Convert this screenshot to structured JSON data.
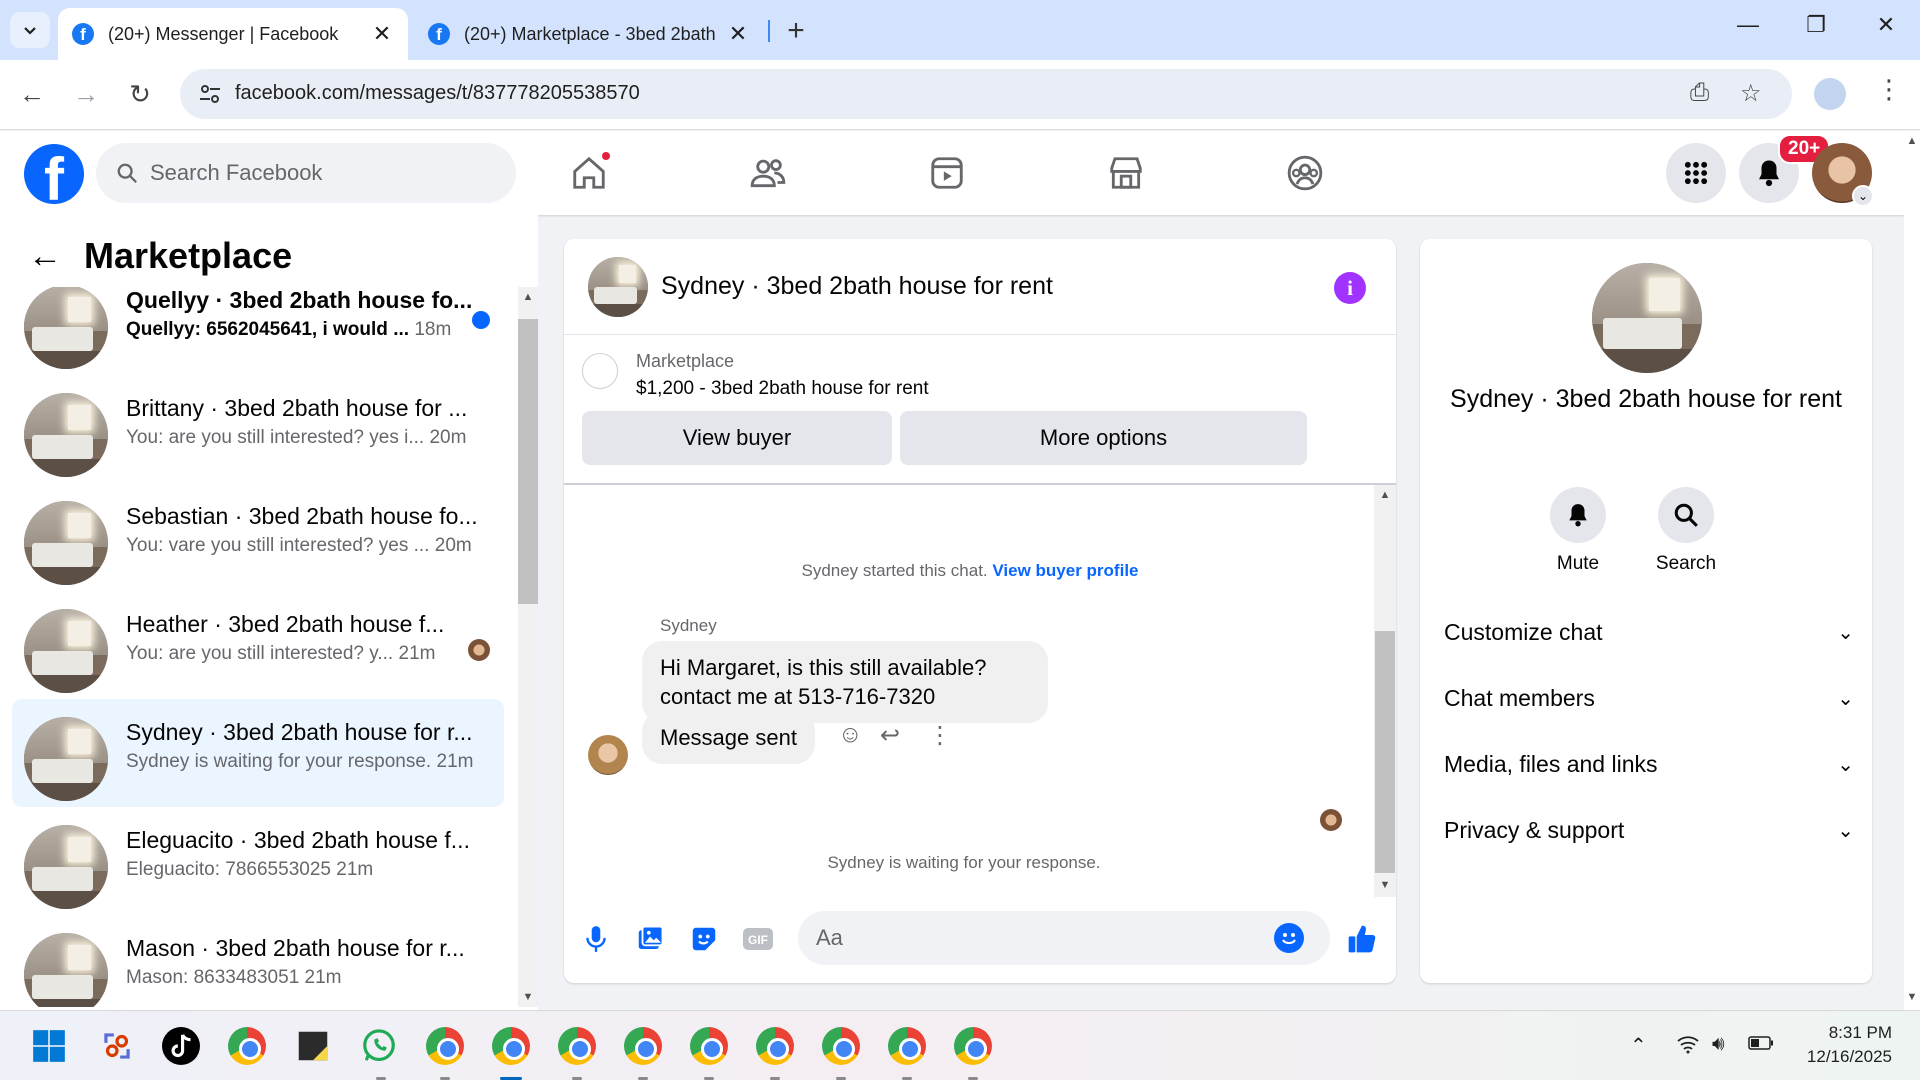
{
  "browser": {
    "tabs": [
      {
        "title": "(20+) Messenger | Facebook",
        "active": true
      },
      {
        "title": "(20+) Marketplace - 3bed 2bath",
        "active": false
      }
    ],
    "url": "facebook.com/messages/t/837778205538570"
  },
  "fb_header": {
    "search_placeholder": "Search Facebook",
    "notifications_badge": "20+",
    "nav_icons": [
      "home-icon",
      "friends-icon",
      "video-icon",
      "marketplace-icon",
      "groups-icon"
    ]
  },
  "sidebar": {
    "title": "Marketplace",
    "conversations": [
      {
        "name": "Quellyy · 3bed 2bath house fo...",
        "preview": "Quellyy: 6562045641, i would ...",
        "time": "18m",
        "unread": true
      },
      {
        "name": "Brittany · 3bed 2bath house for ...",
        "preview": "You: are you still interested? yes i...",
        "time": "20m",
        "unread": false
      },
      {
        "name": "Sebastian · 3bed 2bath house fo...",
        "preview": "You: vare you still interested? yes ...",
        "time": "20m",
        "unread": false
      },
      {
        "name": "Heather · 3bed 2bath house f...",
        "preview": "You: are you still interested? y...",
        "time": "21m",
        "unread": false
      },
      {
        "name": "Sydney · 3bed 2bath house for r...",
        "preview": "Sydney is waiting for your response.",
        "time": "21m",
        "unread": false,
        "active": true
      },
      {
        "name": "Eleguacito · 3bed 2bath house f...",
        "preview": "Eleguacito: 7866553025",
        "time": "21m",
        "unread": false
      },
      {
        "name": "Mason · 3bed 2bath house for r...",
        "preview": "Mason: 8633483051",
        "time": "21m",
        "unread": false
      }
    ]
  },
  "chat": {
    "title": "Sydney · 3bed 2bath house for rent",
    "listing_label": "Marketplace",
    "listing_price": "$1,200 - 3bed 2bath house for rent",
    "view_buyer_label": "View buyer",
    "more_options_label": "More options",
    "started_text": "Sydney started this chat.",
    "view_profile_link": "View buyer profile",
    "sender_name": "Sydney",
    "incoming_message": "Hi Margaret, is this still available?contact me at 513-716-7320",
    "outgoing_message": "Message sent",
    "waiting_text": "Sydney is waiting for your response.",
    "composer_placeholder": "Aa"
  },
  "details": {
    "title": "Sydney · 3bed 2bath house for rent",
    "actions": [
      {
        "label": "Mute"
      },
      {
        "label": "Search"
      }
    ],
    "sections": [
      "Customize chat",
      "Chat members",
      "Media, files and links",
      "Privacy & support"
    ]
  },
  "taskbar": {
    "time": "8:31 PM",
    "date": "12/16/2025"
  },
  "colors": {
    "fb_blue": "#0866ff",
    "info_purple": "#a033ff",
    "badge_red": "#e41e3f"
  }
}
